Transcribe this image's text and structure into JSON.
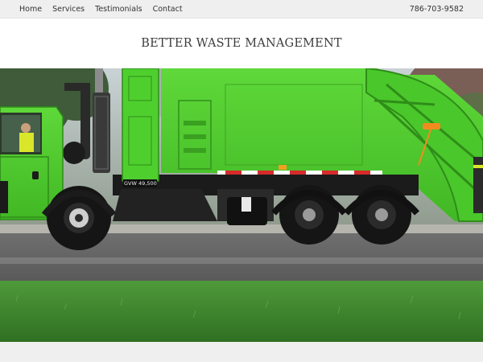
{
  "nav": {
    "items": [
      {
        "label": "Home"
      },
      {
        "label": "Services"
      },
      {
        "label": "Testimonials"
      },
      {
        "label": "Contact"
      }
    ],
    "phone": "786-703-9582"
  },
  "header": {
    "title": "BETTER WASTE MANAGEMENT"
  },
  "hero": {
    "truck_label": "GVW 49,500",
    "accent_color": "#5fd83a"
  }
}
